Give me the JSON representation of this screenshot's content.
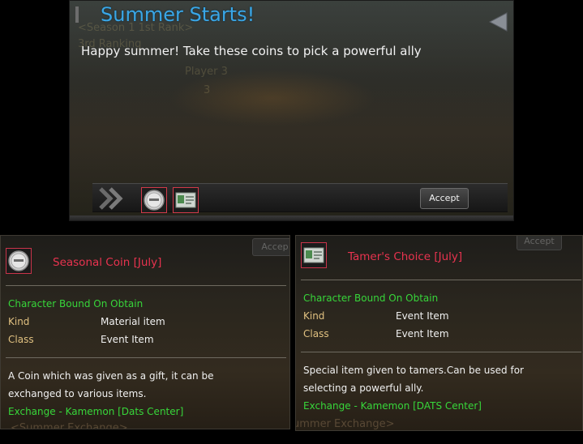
{
  "dialog": {
    "title": "Summer Starts!",
    "message": "Happy summer!  Take these coins to pick a powerful ally",
    "background_text": {
      "line1": "<Season 1 1st Rank>",
      "line2": "3rd Ranking",
      "line3": "Player 3",
      "line4": "3"
    },
    "accept_label": "Accept",
    "rewards": [
      {
        "name": "Seasonal Coin [July]",
        "icon": "coin-icon"
      },
      {
        "name": "Tamer's Choice [July]",
        "icon": "ticket-icon"
      }
    ],
    "title_color": "#3aa6e6"
  },
  "tooltip_left": {
    "ghost_accept": "Accep",
    "name": "Seasonal Coin [July]",
    "bound": "Character Bound On Obtain",
    "kind_label": "Kind",
    "kind_value": "Material item",
    "class_label": "Class",
    "class_value": "Event Item",
    "description_line1": "A Coin which was given as a gift, it can be",
    "description_line2": "exchanged to various items.",
    "exchange": "Exchange - Kamemon [Dats Center]",
    "ghost_footer": "<Summer Exchange>",
    "icon": "coin-icon"
  },
  "tooltip_right": {
    "ghost_accept": "Accept",
    "name": "Tamer's Choice [July]",
    "bound": "Character Bound On Obtain",
    "kind_label": "Kind",
    "kind_value": "Event Item",
    "class_label": "Class",
    "class_value": "Event Item",
    "description_line1": "Special item given to tamers.Can be used for",
    "description_line2": "selecting a powerful ally.",
    "exchange": "Exchange - Kamemon [DATS Center]",
    "ghost_footer": "ummer Exchange>",
    "icon": "ticket-icon"
  },
  "colors": {
    "item_name": "#e8334f",
    "bound_green": "#37d63a",
    "label_gold": "#e0c080"
  }
}
